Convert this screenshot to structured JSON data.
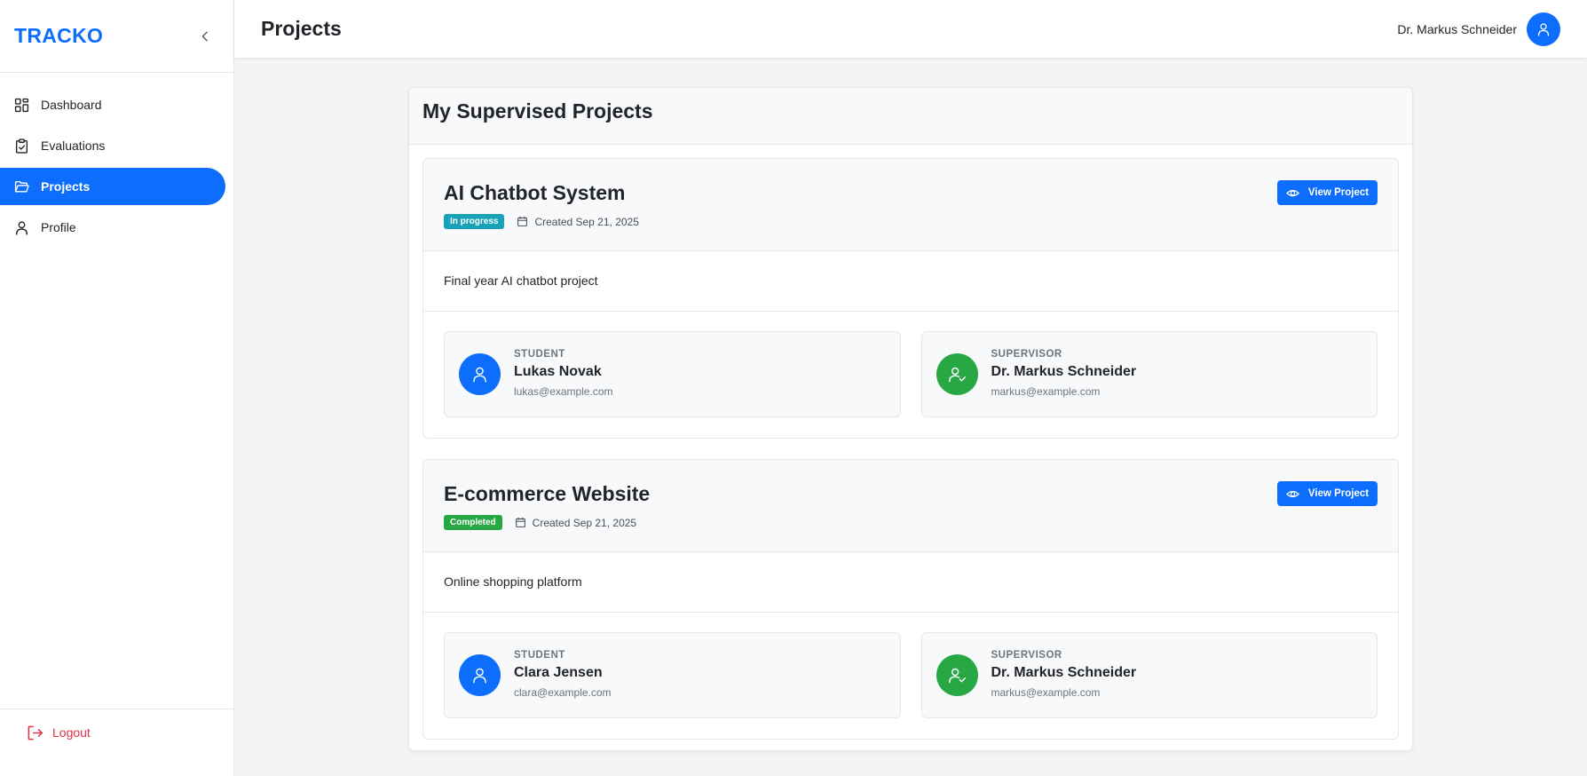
{
  "brand": "TRACKO",
  "colors": {
    "accent": "#0d6efd",
    "success": "#28a745",
    "info": "#17a2b8",
    "danger": "#dc3545"
  },
  "sidebar": {
    "items": [
      {
        "label": "Dashboard",
        "icon": "dashboard-icon",
        "active": false
      },
      {
        "label": "Evaluations",
        "icon": "clipboard-check-icon",
        "active": false
      },
      {
        "label": "Projects",
        "icon": "folder-open-icon",
        "active": true
      },
      {
        "label": "Profile",
        "icon": "user-icon",
        "active": false
      }
    ],
    "logout_label": "Logout"
  },
  "header": {
    "title": "Projects",
    "user_name": "Dr. Markus Schneider"
  },
  "main": {
    "title": "My Supervised Projects",
    "view_label": "View Project",
    "projects": [
      {
        "title": "AI Chatbot System",
        "status": "In progress",
        "status_color": "#17a2b8",
        "created": "Created Sep 21, 2025",
        "description": "Final year AI chatbot project",
        "student": {
          "role": "STUDENT",
          "name": "Lukas Novak",
          "email": "lukas@example.com"
        },
        "supervisor": {
          "role": "SUPERVISOR",
          "name": "Dr. Markus Schneider",
          "email": "markus@example.com"
        }
      },
      {
        "title": "E-commerce Website",
        "status": "Completed",
        "status_color": "#28a745",
        "created": "Created Sep 21, 2025",
        "description": "Online shopping platform",
        "student": {
          "role": "STUDENT",
          "name": "Clara Jensen",
          "email": "clara@example.com"
        },
        "supervisor": {
          "role": "SUPERVISOR",
          "name": "Dr. Markus Schneider",
          "email": "markus@example.com"
        }
      }
    ]
  }
}
